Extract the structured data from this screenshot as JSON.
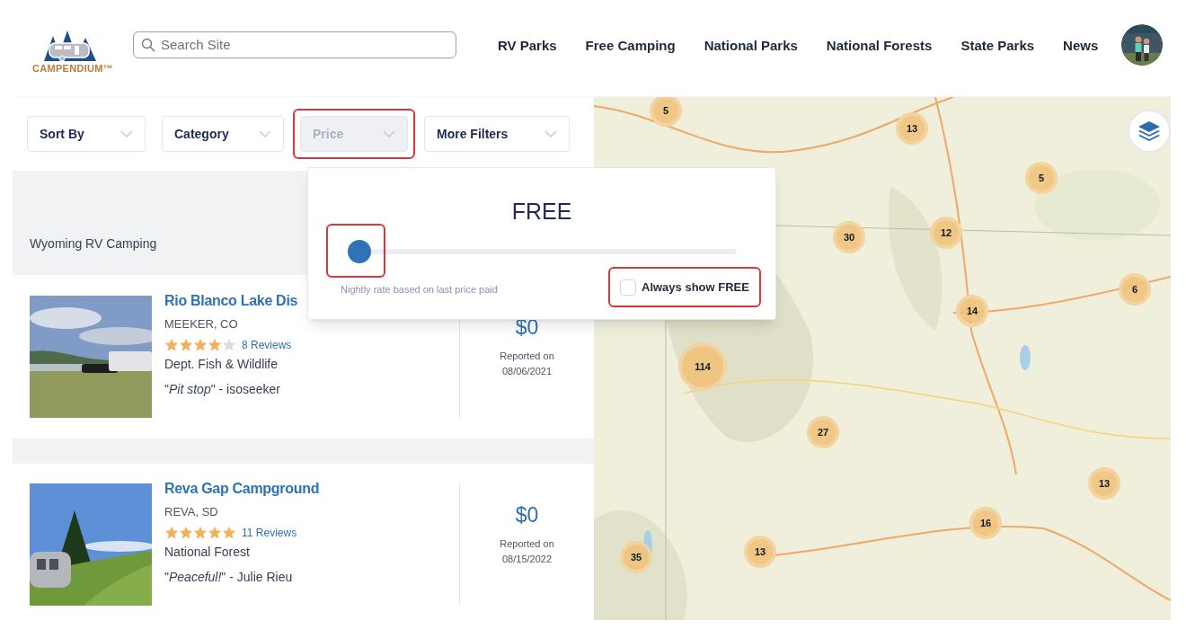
{
  "logo": {
    "text": "CAMPENDIUM™"
  },
  "search": {
    "placeholder": "Search Site"
  },
  "nav": [
    {
      "label": "RV Parks"
    },
    {
      "label": "Free Camping"
    },
    {
      "label": "National Parks"
    },
    {
      "label": "National Forests"
    },
    {
      "label": "State Parks"
    },
    {
      "label": "News"
    }
  ],
  "filters": [
    {
      "label": "Sort By",
      "expanded": false
    },
    {
      "label": "Category",
      "expanded": false
    },
    {
      "label": "Price",
      "expanded": true
    },
    {
      "label": "More Filters",
      "expanded": false
    }
  ],
  "price_popup": {
    "heading": "FREE",
    "level": 0,
    "caption": "Nightly rate based on last price paid",
    "checkbox": {
      "label": "Always show FREE",
      "checked": false
    }
  },
  "banner": {
    "title": "Wyoming RV Camping"
  },
  "listings": [
    {
      "name": "Rio Blanco Lake Dis",
      "location": "MEEKER, CO",
      "stars": 4,
      "reviews": "8 Reviews",
      "category": "Dept. Fish & Wildlife",
      "quote": "\"*Pit stop*\" - isoseeker",
      "price": "$0",
      "reported_label": "Reported on",
      "reported_date": "08/06/2021"
    },
    {
      "name": "Reva Gap Campground",
      "location": "REVA, SD",
      "stars": 5,
      "reviews": "11 Reviews",
      "category": "National Forest",
      "quote": "\"*Peaceful!*\" - Julie Rieu",
      "price": "$0",
      "reported_label": "Reported on",
      "reported_date": "08/15/2022"
    }
  ],
  "map": {
    "clusters": [
      {
        "count": "5"
      },
      {
        "count": "13"
      },
      {
        "count": "5"
      },
      {
        "count": "30"
      },
      {
        "count": "12"
      },
      {
        "count": "14"
      },
      {
        "count": "6"
      },
      {
        "count": "114"
      },
      {
        "count": "27"
      },
      {
        "count": "13"
      },
      {
        "count": "16"
      },
      {
        "count": "13"
      },
      {
        "count": "35"
      }
    ]
  }
}
